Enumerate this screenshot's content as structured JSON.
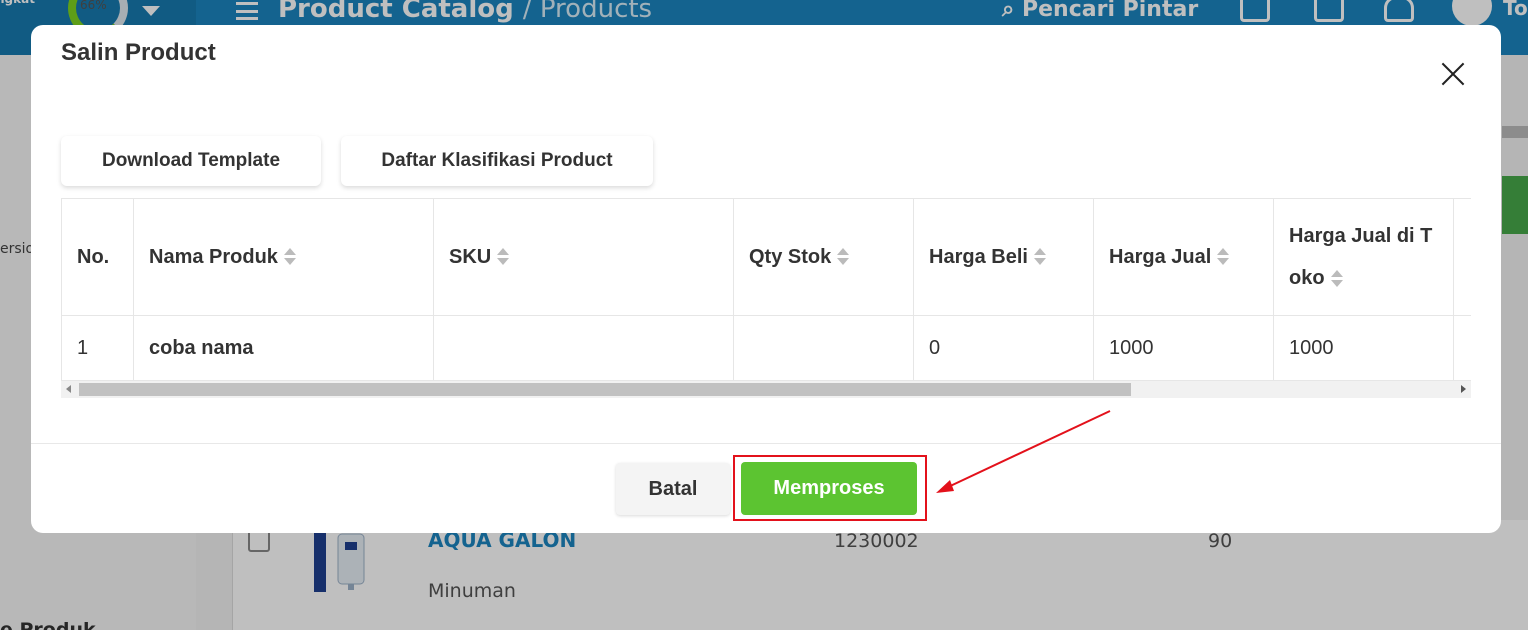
{
  "background": {
    "progress": "66%",
    "brand_fragment": "ngkat",
    "breadcrumb_main": "Product Catalog",
    "breadcrumb_sub": "/ Products",
    "smart_search": "Pencari Pintar",
    "user_fragment": "To",
    "left_versio": "ersio",
    "left_produk": "e Produk",
    "product_row": {
      "name": "AQUA GALON",
      "category": "Minuman",
      "sku": "1230002",
      "qty": "90"
    }
  },
  "modal": {
    "title": "Salin Product",
    "download_template": "Download Template",
    "daftar_klasifikasi": "Daftar Klasifikasi Product",
    "columns": [
      "No.",
      "Nama Produk",
      "SKU",
      "Qty Stok",
      "Harga Beli",
      "Harga Jual",
      "Harga Jual di Toko"
    ],
    "rows": [
      {
        "no": "1",
        "nama": "coba nama",
        "sku": "",
        "qty": "",
        "harga_beli": "0",
        "harga_jual": "1000",
        "harga_jual_toko": "1000"
      }
    ],
    "cancel_label": "Batal",
    "submit_label": "Memproses"
  },
  "colors": {
    "header_blue": "#1b84bf",
    "submit_green": "#5cc431",
    "annotation_red": "#e3111b"
  }
}
